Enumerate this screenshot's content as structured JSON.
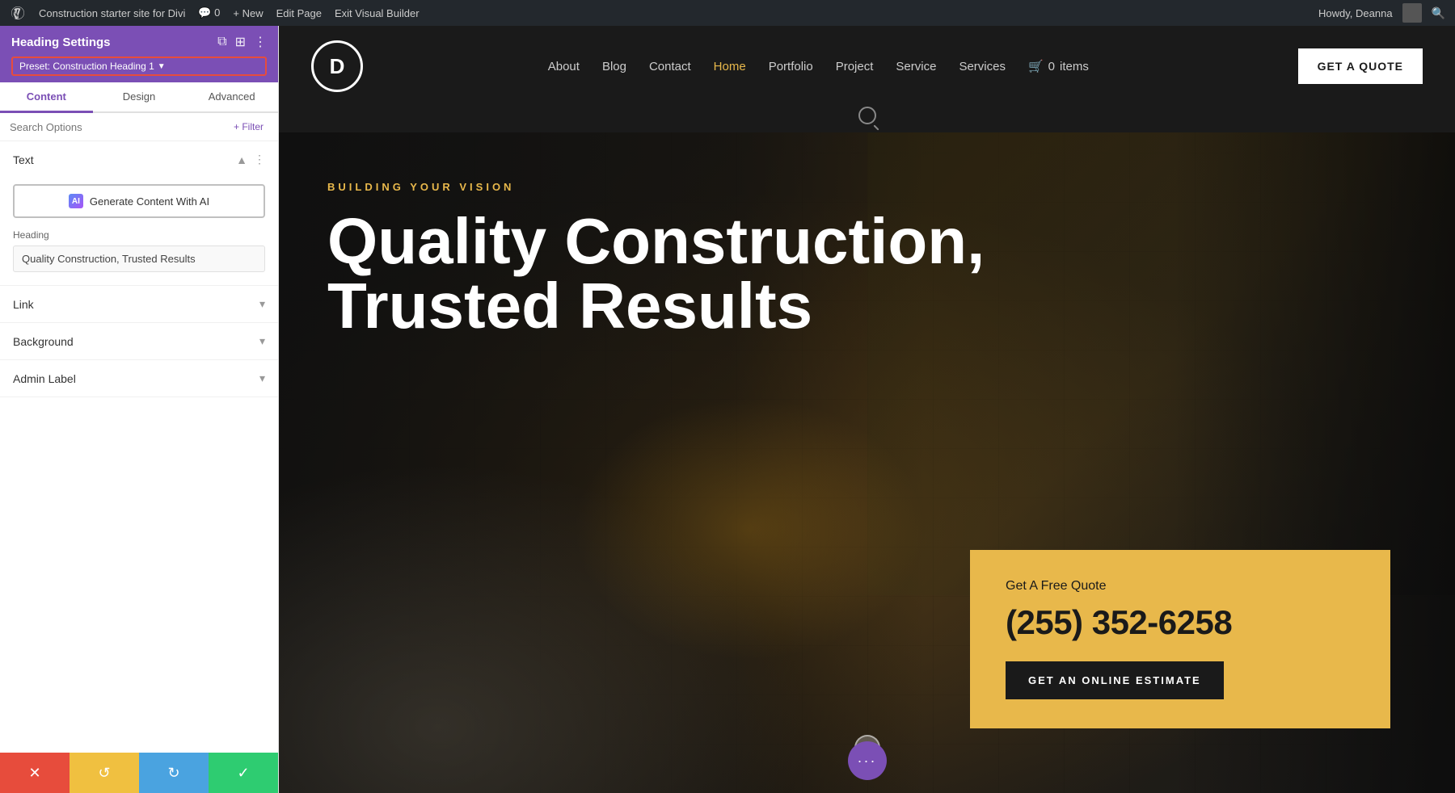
{
  "admin_bar": {
    "wp_icon": "W",
    "site_name": "Construction starter site for Divi",
    "comments_count": "0",
    "new_label": "+ New",
    "edit_page_label": "Edit Page",
    "exit_vb_label": "Exit Visual Builder",
    "user_greeting": "Howdy, Deanna",
    "search_icon": "search-icon"
  },
  "panel": {
    "title": "Heading Settings",
    "preset_label": "Preset: Construction Heading 1",
    "icons": {
      "copy": "⧉",
      "columns": "⊞",
      "more": "⋮"
    },
    "tabs": [
      {
        "id": "content",
        "label": "Content",
        "active": true
      },
      {
        "id": "design",
        "label": "Design",
        "active": false
      },
      {
        "id": "advanced",
        "label": "Advanced",
        "active": false
      }
    ],
    "search": {
      "placeholder": "Search Options",
      "filter_label": "+ Filter"
    },
    "sections": {
      "text": {
        "label": "Text",
        "expanded": true,
        "ai_button_label": "Generate Content With AI",
        "heading_field_label": "Heading",
        "heading_value": "Quality Construction, Trusted Results"
      },
      "link": {
        "label": "Link",
        "expanded": false
      },
      "background": {
        "label": "Background",
        "expanded": false
      },
      "admin_label": {
        "label": "Admin Label",
        "expanded": false
      }
    },
    "bottom_toolbar": {
      "cancel_icon": "✕",
      "undo_icon": "↺",
      "redo_icon": "↻",
      "save_icon": "✓"
    }
  },
  "site": {
    "logo_letter": "D",
    "nav_links": [
      {
        "label": "About",
        "active": false
      },
      {
        "label": "Blog",
        "active": false
      },
      {
        "label": "Contact",
        "active": false
      },
      {
        "label": "Home",
        "active": true
      },
      {
        "label": "Portfolio",
        "active": false
      },
      {
        "label": "Project",
        "active": false
      },
      {
        "label": "Service",
        "active": false
      },
      {
        "label": "Services",
        "active": false
      }
    ],
    "cart_icon": "🛒",
    "cart_count": "0",
    "cart_items_label": "items",
    "get_quote_btn": "GET A QUOTE",
    "hero": {
      "eyebrow": "BUILDING YOUR VISION",
      "title_line1": "Quality Construction,",
      "title_line2": "Trusted Results"
    },
    "quote_card": {
      "label": "Get A Free Quote",
      "phone": "(255) 352-6258",
      "button_label": "GET AN ONLINE ESTIMATE"
    }
  }
}
